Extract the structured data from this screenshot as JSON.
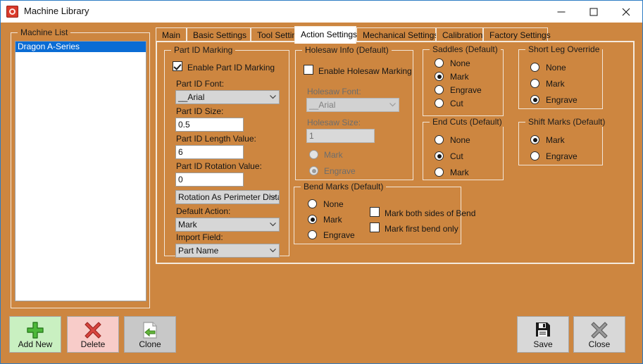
{
  "window": {
    "title": "Machine Library",
    "icon": "app-gauge-icon",
    "controls": {
      "minimize": "minimize-icon",
      "maximize": "maximize-icon",
      "close": "close-icon"
    },
    "accent_color": "#cd8640",
    "border_color": "#2e7cc4"
  },
  "machine_list": {
    "legend": "Machine List",
    "items": [
      {
        "label": "Dragon A-Series",
        "selected": true
      }
    ]
  },
  "tabs": [
    {
      "label": "Main",
      "active": false
    },
    {
      "label": "Basic Settings",
      "active": false
    },
    {
      "label": "Tool Settings",
      "active": false
    },
    {
      "label": "Action Settings",
      "active": true
    },
    {
      "label": "Mechanical Settings",
      "active": false
    },
    {
      "label": "Calibration",
      "active": false
    },
    {
      "label": "Factory Settings",
      "active": false
    }
  ],
  "part_id_marking": {
    "legend": "Part ID Marking",
    "enable": {
      "label": "Enable Part ID Marking",
      "checked": true
    },
    "font_label": "Part ID Font:",
    "font_value": "__Arial",
    "size_label": "Part ID Size:",
    "size_value": "0.5",
    "length_label": "Part ID Length Value:",
    "length_value": "6",
    "rotation_label": "Part ID Rotation Value:",
    "rotation_value": "0",
    "rotation_mode_value": "Rotation As Perimeter Dista",
    "default_action_label": "Default Action:",
    "default_action_value": "Mark",
    "import_field_label": "Import Field:",
    "import_field_value": "Part Name"
  },
  "holesaw_info": {
    "legend": "Holesaw Info (Default)",
    "enable": {
      "label": "Enable Holesaw Marking",
      "checked": false
    },
    "font_label": "Holesaw Font:",
    "font_value": "__Arial",
    "size_label": "Holesaw Size:",
    "size_value": "1",
    "options": [
      {
        "label": "Mark",
        "checked": false
      },
      {
        "label": "Engrave",
        "checked": true
      }
    ],
    "disabled": true
  },
  "bend_marks": {
    "legend": "Bend Marks (Default)",
    "options": [
      {
        "label": "None",
        "checked": false
      },
      {
        "label": "Mark",
        "checked": true
      },
      {
        "label": "Engrave",
        "checked": false
      }
    ],
    "checkboxes": [
      {
        "label": "Mark both sides of Bend",
        "checked": false
      },
      {
        "label": "Mark first bend only",
        "checked": false
      }
    ]
  },
  "saddles": {
    "legend": "Saddles (Default)",
    "options": [
      {
        "label": "None",
        "checked": false
      },
      {
        "label": "Mark",
        "checked": true
      },
      {
        "label": "Engrave",
        "checked": false
      },
      {
        "label": "Cut",
        "checked": false
      }
    ]
  },
  "end_cuts": {
    "legend": "End Cuts (Default)",
    "options": [
      {
        "label": "None",
        "checked": false
      },
      {
        "label": "Cut",
        "checked": true
      },
      {
        "label": "Mark",
        "checked": false
      }
    ]
  },
  "short_leg_override": {
    "legend": "Short Leg Override",
    "options": [
      {
        "label": "None",
        "checked": false
      },
      {
        "label": "Mark",
        "checked": false
      },
      {
        "label": "Engrave",
        "checked": true
      }
    ]
  },
  "shift_marks": {
    "legend": "Shift Marks (Default)",
    "options": [
      {
        "label": "Mark",
        "checked": true
      },
      {
        "label": "Engrave",
        "checked": false
      }
    ]
  },
  "buttons": {
    "add_new": {
      "label": "Add New",
      "icon": "plus-icon",
      "color": "#c9f0c1"
    },
    "delete": {
      "label": "Delete",
      "icon": "x-cross-icon",
      "color": "#f8ccc9"
    },
    "clone": {
      "label": "Clone",
      "icon": "page-arrow-icon",
      "color": "#c8c8c8"
    },
    "save": {
      "label": "Save",
      "icon": "floppy-disk-icon",
      "color": "#d8d8d8"
    },
    "close": {
      "label": "Close",
      "icon": "x-cross-icon",
      "color": "#d8d8d8"
    }
  }
}
